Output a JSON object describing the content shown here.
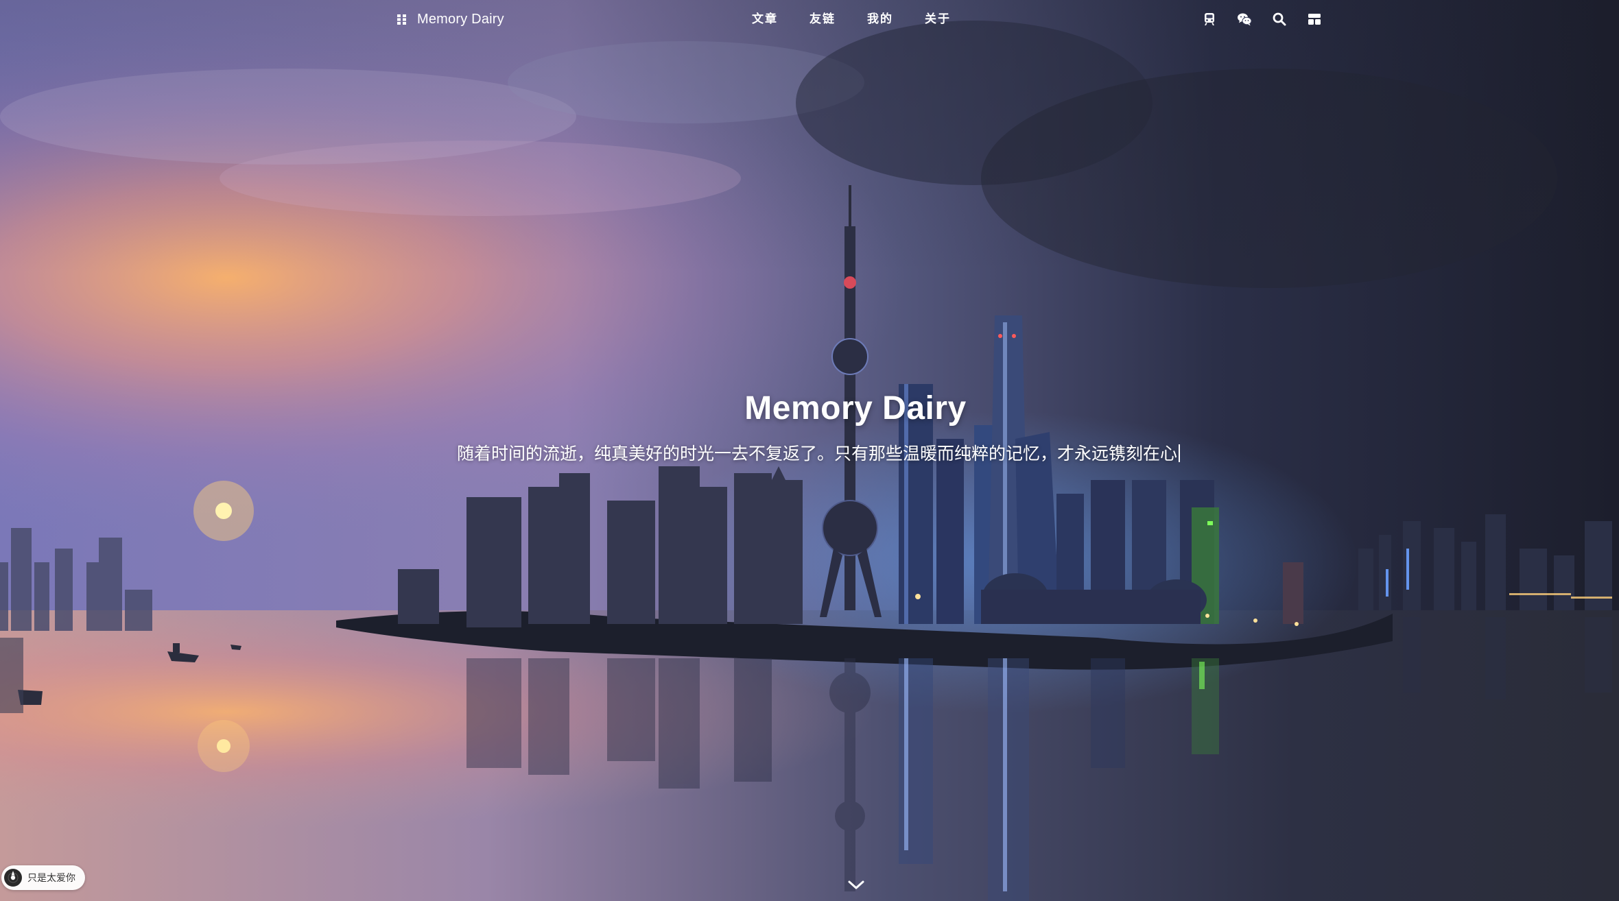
{
  "site": {
    "brand_title": "Memory Dairy",
    "brand_icon": "grid-icon"
  },
  "nav": {
    "items": [
      {
        "label": "文章"
      },
      {
        "label": "友链"
      },
      {
        "label": "我的"
      },
      {
        "label": "关于"
      }
    ]
  },
  "toolbar": {
    "icons": [
      "train-icon",
      "wechat-icon",
      "search-icon",
      "layout-icon"
    ]
  },
  "hero": {
    "title": "Memory Dairy",
    "subtitle": "随着时间的流逝，纯真美好的时光一去不复返了。只有那些温暖而纯粹的记忆，才永远镌刻在心"
  },
  "player": {
    "label": "只是太爱你",
    "icon": "music-disc-icon"
  },
  "scroll": {
    "icon": "chevron-down-icon"
  },
  "colors": {
    "sunset_orange": "#f6a45a",
    "dusk_purple": "#8a7fb8",
    "night_navy": "#1b1f33",
    "city_blue": "#4d86e0",
    "text": "#ffffff"
  }
}
